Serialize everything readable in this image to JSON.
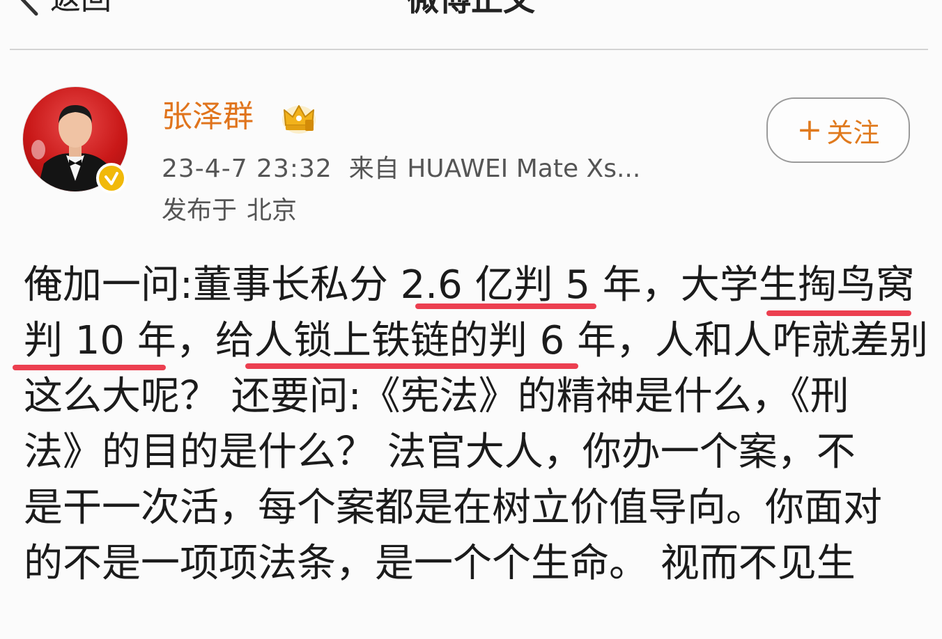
{
  "header": {
    "back_label": "返回",
    "title": "微博正文"
  },
  "author": {
    "name": "张泽群",
    "post_time": "23-4-7 23:32",
    "source": "来自 HUAWEI Mate Xs...",
    "location_prefix": "发布于",
    "location": "北京",
    "verified": true
  },
  "follow_button": {
    "label": "关注",
    "plus": "+"
  },
  "post": {
    "lines": [
      "俺加一问:董事长私分 2.6 亿判 5 年，大学生掏鸟窝",
      "判 10 年，给人锁上铁链的判 6 年，人和人咋就差别",
      "这么大呢？ 还要问:《宪法》的精神是什么，《刑",
      "法》的目的是什么？ 法官大人，你办一个案，不",
      "是干一次活，每个案都是在树立价值导向。你面对",
      "的不是一项项法条，是一个个生命。 视而不见生"
    ]
  },
  "colors": {
    "accent_orange": "#e0741c",
    "underline_red": "#ec3f50",
    "verified_gold": "#f1b90a",
    "avatar_red": "#c91818"
  },
  "icons": {
    "back": "chevron-left-icon",
    "crown": "crown-icon",
    "verified": "verified-badge-icon"
  }
}
